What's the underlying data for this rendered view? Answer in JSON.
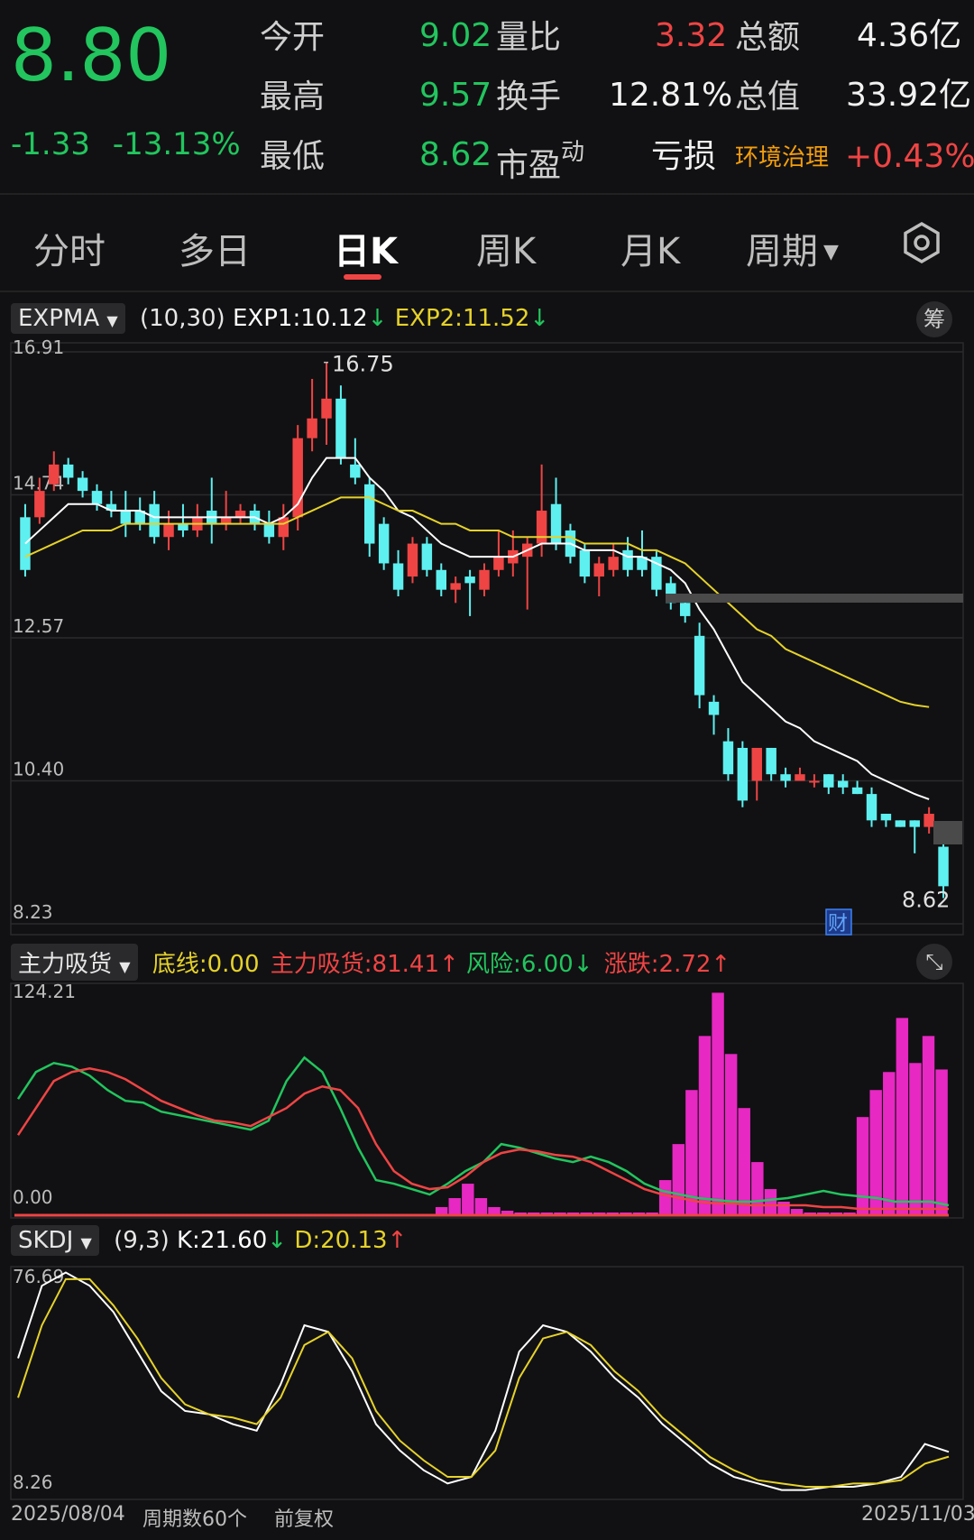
{
  "quote": {
    "price": "8.80",
    "change": "-1.33",
    "change_pct": "-13.13%",
    "rows": [
      {
        "l1": "今开",
        "v1": "9.02",
        "l2": "量比",
        "v2": "3.32",
        "l3": "总额",
        "v3": "4.36亿"
      },
      {
        "l1": "最高",
        "v1": "9.57",
        "l2": "换手",
        "v2": "12.81%",
        "l3": "总值",
        "v3": "33.92亿"
      },
      {
        "l1": "最低",
        "v1": "8.62",
        "l2": "市盈",
        "l2sup": "动",
        "v2": "亏损",
        "l3": "环境治理",
        "v3": "+0.43%"
      }
    ]
  },
  "tabs": [
    "分时",
    "多日",
    "日K",
    "周K",
    "月K",
    "周期"
  ],
  "active_tab": "日K",
  "colors": {
    "up": "#ef4444",
    "down": "#5ef0f0",
    "ma1": "#ffffff",
    "ma2": "#e6d22a",
    "green": "#22c55e",
    "magenta": "#ff2bd6",
    "accent": "#ef4444"
  },
  "main_indicator": {
    "name": "EXPMA",
    "params": "(10,30)",
    "exp1_label": "EXP1:",
    "exp1": "10.12",
    "exp2_label": "EXP2:",
    "exp2": "11.52",
    "chip": "筹"
  },
  "sub1": {
    "name": "主力吸货",
    "bottom_label": "底线:",
    "bottom": "0.00",
    "main_label": "主力吸货:",
    "main": "81.41",
    "risk_label": "风险:",
    "risk": "6.00",
    "chg_label": "涨跌:",
    "chg": "2.72"
  },
  "sub2": {
    "name": "SKDJ",
    "params": "(9,3)",
    "k_label": "K:",
    "k": "21.60",
    "d_label": "D:",
    "d": "20.13"
  },
  "footer": {
    "start_date": "2025/08/04",
    "period_count": "周期数60个",
    "adjust": "前复权",
    "end_date": "2025/11/03"
  },
  "chart_data": [
    {
      "type": "candlestick",
      "title": "EXPMA (10,30)",
      "y_ticks": [
        "16.91",
        "14.74",
        "12.57",
        "10.40",
        "8.23"
      ],
      "ylim": [
        8.23,
        16.91
      ],
      "high_label": "16.75",
      "low_label": "8.62",
      "marker": "财",
      "candles": [
        [
          14.4,
          13.6,
          14.6,
          13.5
        ],
        [
          14.4,
          14.8,
          15.0,
          14.3
        ],
        [
          14.9,
          15.2,
          15.4,
          14.8
        ],
        [
          15.2,
          15.0,
          15.3,
          14.9
        ],
        [
          15.0,
          14.8,
          15.1,
          14.7
        ],
        [
          14.8,
          14.6,
          14.9,
          14.5
        ],
        [
          14.6,
          14.5,
          14.8,
          14.4
        ],
        [
          14.5,
          14.3,
          14.8,
          14.1
        ],
        [
          14.5,
          14.3,
          14.7,
          14.2
        ],
        [
          14.6,
          14.1,
          14.8,
          14.0
        ],
        [
          14.1,
          14.3,
          14.5,
          13.9
        ],
        [
          14.3,
          14.2,
          14.6,
          14.1
        ],
        [
          14.2,
          14.4,
          14.6,
          14.1
        ],
        [
          14.5,
          14.3,
          15.0,
          14.0
        ],
        [
          14.3,
          14.4,
          14.8,
          14.2
        ],
        [
          14.4,
          14.5,
          14.6,
          14.3
        ],
        [
          14.5,
          14.3,
          14.6,
          14.2
        ],
        [
          14.3,
          14.1,
          14.5,
          14.0
        ],
        [
          14.1,
          14.4,
          14.6,
          13.9
        ],
        [
          14.4,
          15.6,
          15.8,
          14.2
        ],
        [
          15.6,
          15.9,
          16.5,
          15.4
        ],
        [
          15.9,
          16.2,
          16.75,
          15.5
        ],
        [
          16.2,
          15.3,
          16.4,
          15.2
        ],
        [
          15.2,
          15.0,
          15.6,
          14.9
        ],
        [
          14.9,
          14.0,
          15.0,
          13.8
        ],
        [
          14.3,
          13.7,
          14.4,
          13.6
        ],
        [
          13.7,
          13.3,
          13.9,
          13.2
        ],
        [
          13.5,
          14.0,
          14.1,
          13.4
        ],
        [
          14.0,
          13.6,
          14.1,
          13.5
        ],
        [
          13.6,
          13.3,
          13.7,
          13.2
        ],
        [
          13.3,
          13.4,
          13.5,
          13.1
        ],
        [
          13.5,
          13.4,
          13.6,
          12.9
        ],
        [
          13.3,
          13.6,
          13.7,
          13.2
        ],
        [
          13.6,
          13.8,
          14.2,
          13.5
        ],
        [
          13.7,
          13.9,
          14.2,
          13.5
        ],
        [
          13.8,
          14.0,
          14.1,
          13.0
        ],
        [
          14.0,
          14.5,
          15.2,
          13.8
        ],
        [
          14.6,
          14.0,
          15.0,
          13.9
        ],
        [
          14.2,
          13.8,
          14.3,
          13.7
        ],
        [
          13.9,
          13.5,
          14.0,
          13.4
        ],
        [
          13.5,
          13.7,
          13.8,
          13.2
        ],
        [
          13.6,
          13.8,
          14.0,
          13.5
        ],
        [
          13.9,
          13.6,
          14.1,
          13.5
        ],
        [
          13.8,
          13.6,
          14.2,
          13.5
        ],
        [
          13.8,
          13.3,
          13.9,
          13.2
        ],
        [
          13.4,
          13.1,
          13.5,
          13.0
        ],
        [
          13.1,
          12.9,
          13.2,
          12.8
        ],
        [
          12.6,
          11.7,
          12.8,
          11.5
        ],
        [
          11.6,
          11.4,
          11.7,
          11.1
        ],
        [
          11.0,
          10.5,
          11.2,
          10.4
        ],
        [
          10.9,
          10.1,
          11.0,
          10.0
        ],
        [
          10.4,
          10.9,
          10.9,
          10.1
        ],
        [
          10.9,
          10.5,
          10.9,
          10.4
        ],
        [
          10.5,
          10.4,
          10.6,
          10.3
        ],
        [
          10.4,
          10.5,
          10.6,
          10.4
        ],
        [
          10.4,
          10.4,
          10.5,
          10.3
        ],
        [
          10.5,
          10.3,
          10.5,
          10.2
        ],
        [
          10.4,
          10.3,
          10.5,
          10.2
        ],
        [
          10.3,
          10.2,
          10.4,
          10.2
        ],
        [
          10.2,
          9.8,
          10.3,
          9.7
        ],
        [
          9.9,
          9.8,
          9.9,
          9.7
        ],
        [
          9.8,
          9.7,
          9.8,
          9.7
        ],
        [
          9.8,
          9.7,
          9.8,
          9.3
        ],
        [
          9.7,
          9.9,
          10.0,
          9.6
        ],
        [
          9.4,
          8.8,
          9.57,
          8.62
        ]
      ],
      "series": [
        {
          "name": "EXP1",
          "values": [
            14.0,
            14.2,
            14.4,
            14.6,
            14.6,
            14.6,
            14.5,
            14.5,
            14.5,
            14.4,
            14.4,
            14.4,
            14.4,
            14.4,
            14.4,
            14.4,
            14.4,
            14.3,
            14.4,
            14.6,
            15.0,
            15.3,
            15.3,
            15.3,
            15.0,
            14.8,
            14.5,
            14.4,
            14.2,
            14.0,
            13.9,
            13.8,
            13.8,
            13.8,
            13.8,
            13.9,
            14.0,
            14.0,
            14.0,
            13.9,
            13.9,
            13.9,
            13.8,
            13.8,
            13.7,
            13.6,
            13.4,
            13.0,
            12.7,
            12.3,
            11.9,
            11.7,
            11.5,
            11.3,
            11.2,
            11.0,
            10.9,
            10.8,
            10.7,
            10.5,
            10.4,
            10.3,
            10.2,
            10.12
          ]
        },
        {
          "name": "EXP2",
          "values": [
            13.8,
            13.9,
            14.0,
            14.1,
            14.2,
            14.2,
            14.2,
            14.3,
            14.3,
            14.3,
            14.3,
            14.3,
            14.3,
            14.3,
            14.3,
            14.3,
            14.3,
            14.3,
            14.3,
            14.4,
            14.5,
            14.6,
            14.7,
            14.7,
            14.7,
            14.6,
            14.5,
            14.5,
            14.4,
            14.3,
            14.3,
            14.2,
            14.2,
            14.2,
            14.1,
            14.1,
            14.1,
            14.1,
            14.1,
            14.0,
            14.0,
            14.0,
            14.0,
            13.9,
            13.9,
            13.8,
            13.7,
            13.5,
            13.3,
            13.1,
            12.9,
            12.7,
            12.6,
            12.4,
            12.3,
            12.2,
            12.1,
            12.0,
            11.9,
            11.8,
            11.7,
            11.6,
            11.55,
            11.52
          ]
        }
      ]
    },
    {
      "type": "line+bar",
      "title": "主力吸货",
      "y_ticks": [
        "124.21",
        "0.00"
      ],
      "ylim": [
        0,
        124.21
      ],
      "bars": [
        0,
        0,
        0,
        0,
        0,
        0,
        0,
        0,
        0,
        0,
        0,
        0,
        0,
        0,
        0,
        0,
        0,
        0,
        0,
        0,
        0,
        0,
        0,
        0,
        0,
        0,
        0,
        0,
        0,
        0,
        0,
        0,
        5,
        10,
        18,
        10,
        5,
        3,
        2,
        2,
        2,
        2,
        2,
        2,
        2,
        2,
        2,
        2,
        2,
        20,
        40,
        70,
        100,
        124,
        90,
        60,
        30,
        15,
        8,
        4,
        2,
        2,
        2,
        2,
        55,
        70,
        80,
        110,
        85,
        100,
        81.41
      ],
      "series": [
        {
          "name": "A",
          "values": [
            65,
            80,
            85,
            83,
            78,
            70,
            64,
            63,
            58,
            56,
            54,
            52,
            50,
            48,
            53,
            75,
            88,
            80,
            60,
            38,
            20,
            18,
            15,
            12,
            18,
            25,
            30,
            40,
            38,
            35,
            32,
            30,
            33,
            30,
            25,
            18,
            14,
            12,
            10,
            9,
            8,
            8,
            9,
            10,
            12,
            14,
            12,
            11,
            10,
            8,
            8,
            8,
            6
          ]
        },
        {
          "name": "B",
          "values": [
            45,
            60,
            75,
            80,
            82,
            80,
            76,
            70,
            64,
            60,
            56,
            53,
            52,
            50,
            55,
            60,
            68,
            72,
            70,
            60,
            40,
            25,
            18,
            15,
            16,
            22,
            30,
            35,
            37,
            36,
            34,
            33,
            30,
            25,
            20,
            15,
            12,
            10,
            8,
            7,
            7,
            6,
            6,
            6,
            6,
            5,
            5,
            4,
            4,
            4,
            4,
            4,
            4
          ]
        }
      ]
    },
    {
      "type": "line",
      "title": "SKDJ (9,3)",
      "y_ticks": [
        "76.69",
        "8.26"
      ],
      "ylim": [
        8.26,
        76.69
      ],
      "series": [
        {
          "name": "K",
          "values": [
            50,
            72,
            76,
            72,
            64,
            52,
            40,
            34,
            33,
            30,
            28,
            42,
            60,
            58,
            46,
            30,
            22,
            16,
            12,
            14,
            28,
            52,
            60,
            58,
            52,
            44,
            38,
            30,
            24,
            18,
            14,
            12,
            10,
            10,
            11,
            11,
            12,
            14,
            24,
            21.6
          ]
        },
        {
          "name": "D",
          "values": [
            38,
            60,
            74,
            74,
            66,
            56,
            44,
            36,
            33,
            32,
            30,
            38,
            54,
            58,
            50,
            34,
            25,
            19,
            14,
            14,
            22,
            44,
            56,
            58,
            54,
            46,
            40,
            32,
            26,
            20,
            16,
            13,
            12,
            11,
            11,
            12,
            12,
            13,
            18,
            20.13
          ]
        }
      ]
    }
  ]
}
